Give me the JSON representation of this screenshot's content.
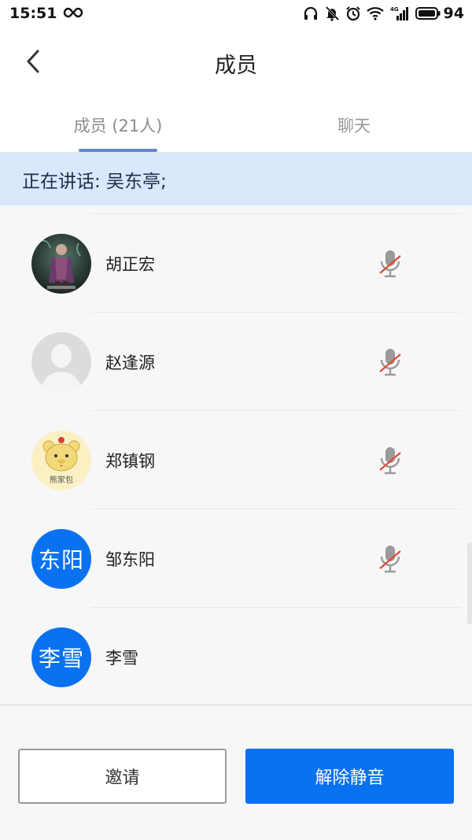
{
  "status_bar": {
    "time": "15:51",
    "battery": "94",
    "network": "4G"
  },
  "header": {
    "title": "成员",
    "back_icon": "chevron-left-icon"
  },
  "tabs": [
    {
      "label": "成员 (21人)",
      "active": true
    },
    {
      "label": "聊天",
      "active": false
    }
  ],
  "speaking": {
    "text": "正在讲话: 吴东亭;"
  },
  "members": [
    {
      "name": "胡正宏",
      "avatar_type": "photo-dark-figure",
      "muted": true
    },
    {
      "name": "赵逢源",
      "avatar_type": "default-person",
      "muted": true
    },
    {
      "name": "郑镇钢",
      "avatar_type": "cartoon-bear",
      "avatar_caption": "熊家包",
      "muted": true
    },
    {
      "name": "邹东阳",
      "avatar_type": "text",
      "avatar_text": "东阳",
      "muted": true
    },
    {
      "name": "李雪",
      "avatar_type": "text",
      "avatar_text": "李雪",
      "muted": false
    }
  ],
  "actions": {
    "invite_label": "邀请",
    "unmute_label": "解除静音"
  },
  "colors": {
    "accent": "#0a72f0",
    "banner_bg": "#d9e8fb",
    "tab_indicator": "#5b87d8",
    "mic_muted_slash": "#e04b3a",
    "mic_gray": "#9a9a9a"
  }
}
